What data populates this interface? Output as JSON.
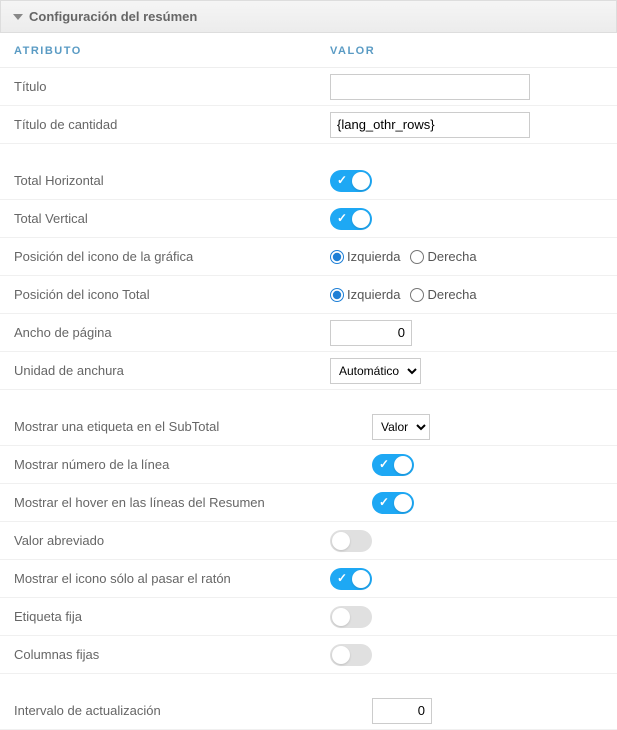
{
  "panel": {
    "title": "Configuración del resúmen"
  },
  "columns": {
    "attr": "ATRIBUTO",
    "val": "VALOR"
  },
  "rows": {
    "titulo": {
      "label": "Título",
      "value": ""
    },
    "titulo_cantidad": {
      "label": "Título de cantidad",
      "value": "{lang_othr_rows}"
    },
    "total_horizontal": {
      "label": "Total Horizontal"
    },
    "total_vertical": {
      "label": "Total Vertical"
    },
    "pos_icono_grafica": {
      "label": "Posición del icono de la gráfica",
      "opt_left": "Izquierda",
      "opt_right": "Derecha"
    },
    "pos_icono_total": {
      "label": "Posición del icono Total",
      "opt_left": "Izquierda",
      "opt_right": "Derecha"
    },
    "ancho_pagina": {
      "label": "Ancho de página",
      "value": "0"
    },
    "unidad_anchura": {
      "label": "Unidad de anchura",
      "selected": "Automático"
    },
    "mostrar_etiqueta_subtotal": {
      "label": "Mostrar una etiqueta en el SubTotal",
      "selected": "Valor"
    },
    "mostrar_num_linea": {
      "label": "Mostrar número de la línea"
    },
    "mostrar_hover": {
      "label": "Mostrar el hover en las líneas del Resumen"
    },
    "valor_abreviado": {
      "label": "Valor abreviado"
    },
    "mostrar_icono_raton": {
      "label": "Mostrar el icono sólo al pasar el ratón"
    },
    "etiqueta_fija": {
      "label": "Etiqueta fija"
    },
    "columnas_fijas": {
      "label": "Columnas fijas"
    },
    "intervalo_actualizacion": {
      "label": "Intervalo de actualización",
      "value": "0"
    }
  }
}
